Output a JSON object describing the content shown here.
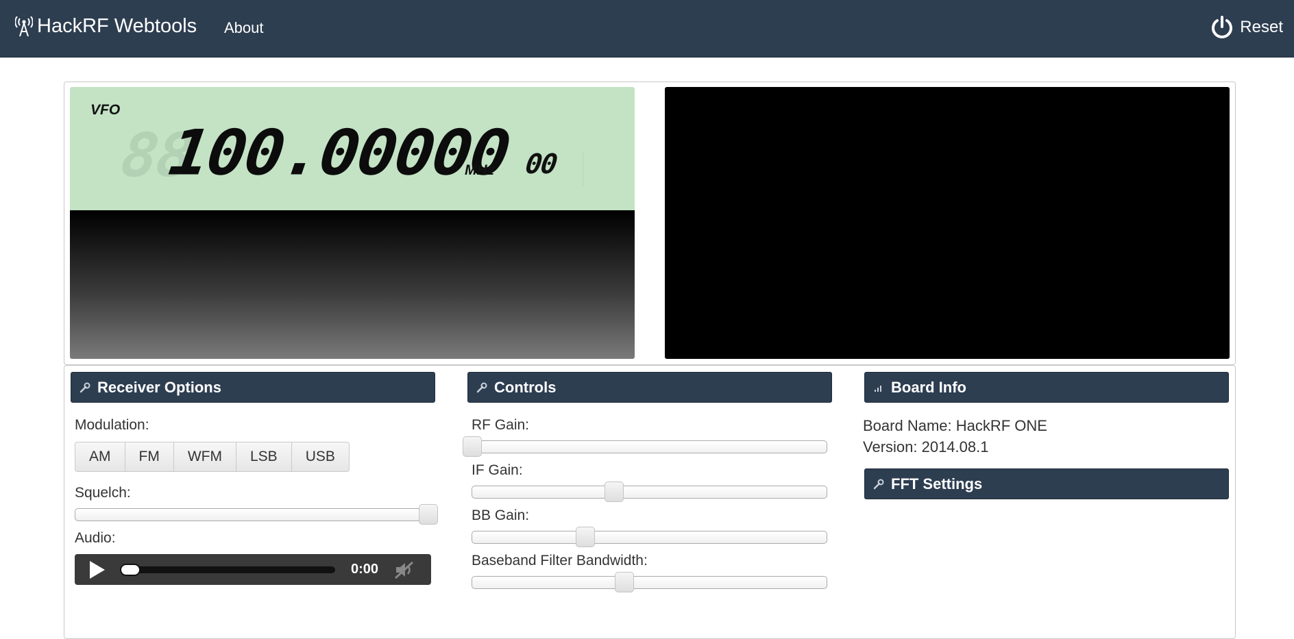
{
  "navbar": {
    "brand": "HackRF Webtools",
    "about": "About",
    "reset": "Reset"
  },
  "vfo": {
    "label": "VFO",
    "ghost_digits": "88",
    "frequency": "100.00000",
    "unit": "MHz",
    "sub_digits": "00"
  },
  "receiver_options": {
    "title": "Receiver Options",
    "modulation_label": "Modulation:",
    "modes": [
      "AM",
      "FM",
      "WFM",
      "LSB",
      "USB"
    ],
    "squelch_label": "Squelch:",
    "squelch_value": 1.0,
    "audio_label": "Audio:",
    "audio_time": "0:00"
  },
  "controls": {
    "title": "Controls",
    "rf_gain_label": "RF Gain:",
    "rf_gain_value": 0.0,
    "if_gain_label": "IF Gain:",
    "if_gain_value": 0.4,
    "bb_gain_label": "BB Gain:",
    "bb_gain_value": 0.32,
    "bb_filter_label": "Baseband Filter Bandwidth:",
    "bb_filter_value": 0.43
  },
  "board_info": {
    "title": "Board Info",
    "board_name": "Board Name: HackRF ONE",
    "version": "Version: 2014.08.1"
  },
  "fft_settings": {
    "title": "FFT Settings"
  },
  "icons": [
    "antenna-icon",
    "power-icon",
    "wrench-icon",
    "signal-icon",
    "play-icon",
    "mute-icon"
  ]
}
